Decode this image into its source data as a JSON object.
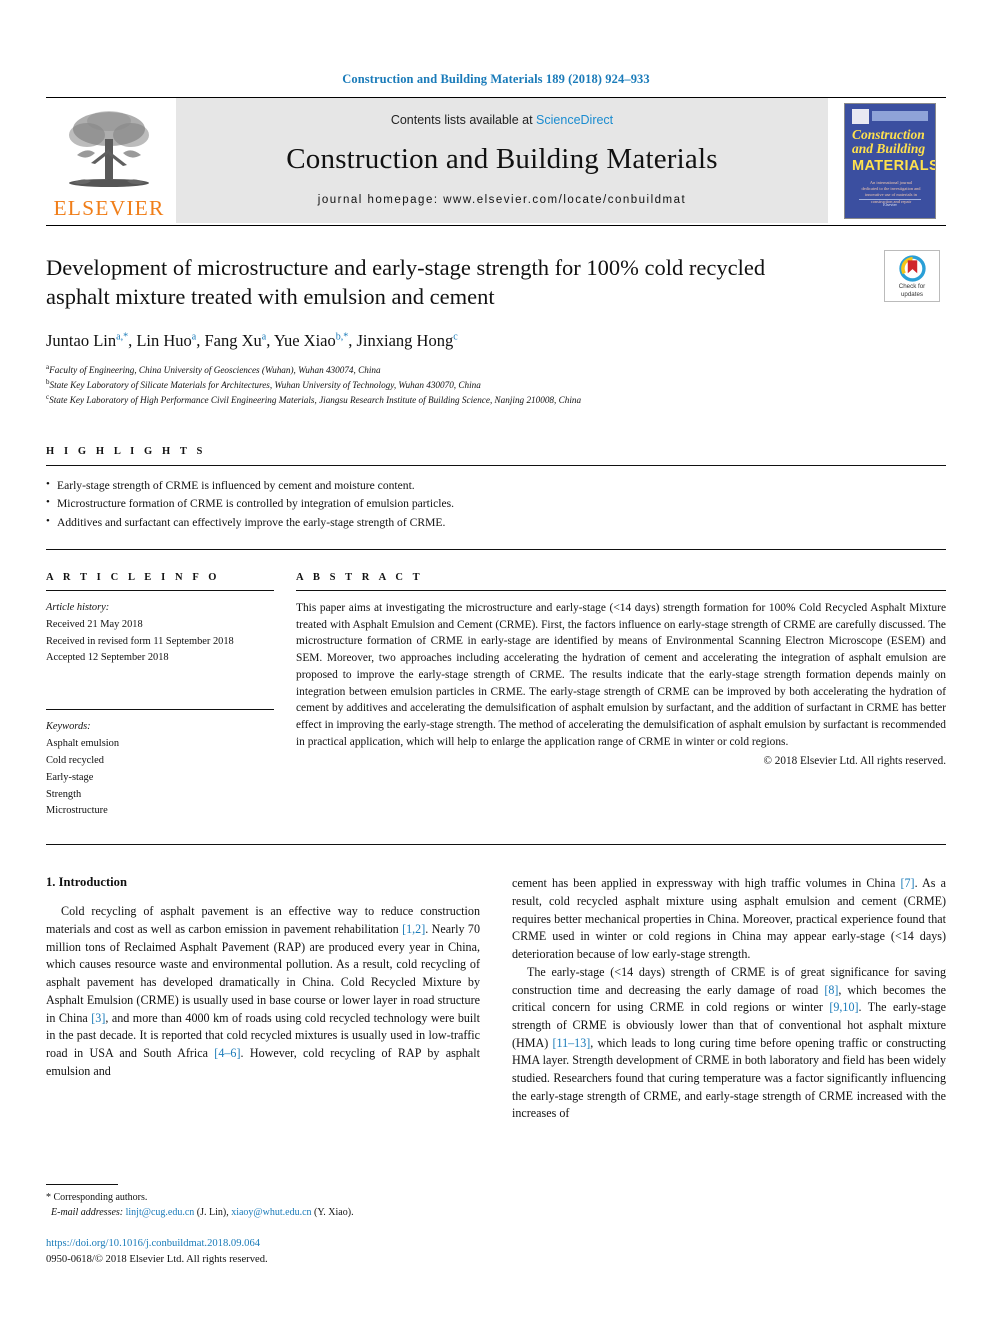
{
  "running_head": "Construction and Building Materials 189 (2018) 924–933",
  "masthead": {
    "publisher_logo_text": "ELSEVIER",
    "contents_prefix": "Contents lists available at",
    "contents_link": "ScienceDirect",
    "journal_name": "Construction and Building Materials",
    "homepage_line": "journal homepage: www.elsevier.com/locate/conbuildmat",
    "cover": {
      "line1": "Construction",
      "line2": "and Building",
      "line3": "MATERIALS",
      "subtitle": "An international journal dedicated to the investigation and innovative use of materials in construction and repair",
      "footer": "Elsevier"
    }
  },
  "article": {
    "title": "Development of microstructure and early-stage strength for 100% cold recycled asphalt mixture treated with emulsion and cement",
    "crossmark": {
      "line1": "Check for",
      "line2": "updates"
    },
    "authors": [
      {
        "name": "Juntao Lin",
        "marks": "a,*"
      },
      {
        "name": "Lin Huo",
        "marks": "a"
      },
      {
        "name": "Fang Xu",
        "marks": "a"
      },
      {
        "name": "Yue Xiao",
        "marks": "b,*"
      },
      {
        "name": "Jinxiang Hong",
        "marks": "c"
      }
    ],
    "affiliations": [
      {
        "mark": "a",
        "text": "Faculty of Engineering, China University of Geosciences (Wuhan), Wuhan 430074, China"
      },
      {
        "mark": "b",
        "text": "State Key Laboratory of Silicate Materials for Architectures, Wuhan University of Technology, Wuhan 430070, China"
      },
      {
        "mark": "c",
        "text": "State Key Laboratory of High Performance Civil Engineering Materials, Jiangsu Research Institute of Building Science, Nanjing 210008, China"
      }
    ]
  },
  "highlights": {
    "label": "H I G H L I G H T S",
    "items": [
      "Early-stage strength of CRME is influenced by cement and moisture content.",
      "Microstructure formation of CRME is controlled by integration of emulsion particles.",
      "Additives and surfactant can effectively improve the early-stage strength of CRME."
    ]
  },
  "article_info": {
    "label": "A R T I C L E  I N F O",
    "history_title": "Article history:",
    "history": [
      "Received 21 May 2018",
      "Received in revised form 11 September 2018",
      "Accepted 12 September 2018"
    ],
    "keywords_title": "Keywords:",
    "keywords": [
      "Asphalt emulsion",
      "Cold recycled",
      "Early-stage",
      "Strength",
      "Microstructure"
    ]
  },
  "abstract": {
    "label": "A B S T R A C T",
    "text": "This paper aims at investigating the microstructure and early-stage (<14 days) strength formation for 100% Cold Recycled Asphalt Mixture treated with Asphalt Emulsion and Cement (CRME). First, the factors influence on early-stage strength of CRME are carefully discussed. The microstructure formation of CRME in early-stage are identified by means of Environmental Scanning Electron Microscope (ESEM) and SEM. Moreover, two approaches including accelerating the hydration of cement and accelerating the integration of asphalt emulsion are proposed to improve the early-stage strength of CRME. The results indicate that the early-stage strength formation depends mainly on integration between emulsion particles in CRME. The early-stage strength of CRME can be improved by both accelerating the hydration of cement by additives and accelerating the demulsification of asphalt emulsion by surfactant, and the addition of surfactant in CRME has better effect in improving the early-stage strength. The method of accelerating the demulsification of asphalt emulsion by surfactant is recommended in practical application, which will help to enlarge the application range of CRME in winter or cold regions.",
    "copyright": "© 2018 Elsevier Ltd. All rights reserved."
  },
  "body": {
    "section_heading": "1. Introduction",
    "left_column": {
      "p1_a": "Cold recycling of asphalt pavement is an effective way to reduce construction materials and cost as well as carbon emission in pavement rehabilitation ",
      "p1_cite1": "[1,2]",
      "p1_b": ". Nearly 70 million tons of Reclaimed Asphalt Pavement (RAP) are produced every year in China, which causes resource waste and environmental pollution. As a result, cold recycling of asphalt pavement has developed dramatically in China. Cold Recycled Mixture by Asphalt Emulsion (CRME) is usually used in base course or lower layer in road structure in China ",
      "p1_cite2": "[3]",
      "p1_c": ", and more than 4000 km of roads using cold recycled technology were built in the past decade. It is reported that cold recycled mixtures is usually used in low-traffic road in USA and South Africa ",
      "p1_cite3": "[4–6]",
      "p1_d": ". However, cold recycling of RAP by asphalt emulsion and"
    },
    "right_column": {
      "p2_a": "cement has been applied in expressway with high traffic volumes in China ",
      "p2_cite1": "[7]",
      "p2_b": ". As a result, cold recycled asphalt mixture using asphalt emulsion and cement (CRME) requires better mechanical properties in China. Moreover, practical experience found that CRME used in winter or cold regions in China may appear early-stage (<14 days) deterioration because of low early-stage strength.",
      "p3_a": "The early-stage (<14 days) strength of CRME is of great significance for saving construction time and decreasing the early damage of road ",
      "p3_cite1": "[8]",
      "p3_b": ", which becomes the critical concern for using CRME in cold regions or winter ",
      "p3_cite2": "[9,10]",
      "p3_c": ". The early-stage strength of CRME is obviously lower than that of conventional hot asphalt mixture (HMA) ",
      "p3_cite3": "[11–13]",
      "p3_d": ", which leads to long curing time before opening traffic or constructing HMA layer. Strength development of CRME in both laboratory and field has been widely studied. Researchers found that curing temperature was a factor significantly influencing the early-stage strength of CRME, and early-stage strength of CRME increased with the increases of"
    }
  },
  "footnote": {
    "corresponding": "* Corresponding authors.",
    "email_label": "E-mail addresses:",
    "email1": "linjt@cug.edu.cn",
    "email1_owner": "(J. Lin),",
    "email2": "xiaoy@whut.edu.cn",
    "email2_owner": "(Y. Xiao).",
    "doi": "https://doi.org/10.1016/j.conbuildmat.2018.09.064",
    "issn": "0950-0618/© 2018 Elsevier Ltd. All rights reserved."
  },
  "colors": {
    "link_blue": "#1a7bb9",
    "sciencedirect_blue": "#1a8cd0",
    "elsevier_orange": "#f07e19",
    "cover_blue": "#3b4fa0",
    "cover_yellow": "#ffe14d",
    "banner_grey": "#e6e6e6"
  }
}
